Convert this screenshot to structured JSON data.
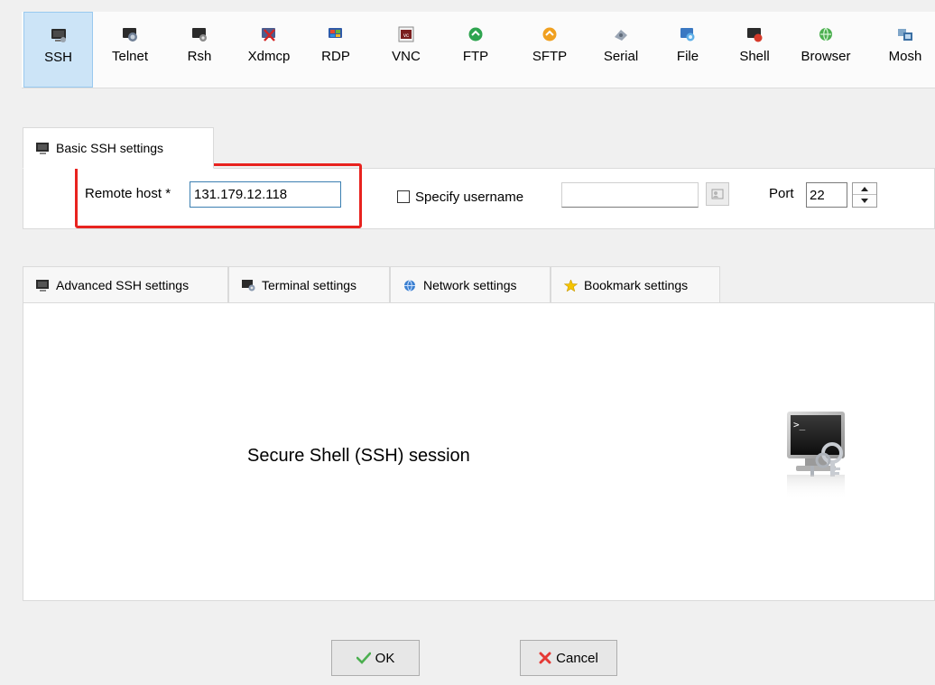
{
  "toolbar": {
    "items": [
      {
        "label": "SSH",
        "icon": "ssh-icon",
        "active": true
      },
      {
        "label": "Telnet",
        "icon": "telnet-icon"
      },
      {
        "label": "Rsh",
        "icon": "rsh-icon"
      },
      {
        "label": "Xdmcp",
        "icon": "xdmcp-icon"
      },
      {
        "label": "RDP",
        "icon": "rdp-icon"
      },
      {
        "label": "VNC",
        "icon": "vnc-icon"
      },
      {
        "label": "FTP",
        "icon": "ftp-icon"
      },
      {
        "label": "SFTP",
        "icon": "sftp-icon"
      },
      {
        "label": "Serial",
        "icon": "serial-icon"
      },
      {
        "label": "File",
        "icon": "file-icon"
      },
      {
        "label": "Shell",
        "icon": "shell-icon"
      },
      {
        "label": "Browser",
        "icon": "browser-icon"
      },
      {
        "label": "Mosh",
        "icon": "mosh-icon"
      }
    ]
  },
  "basic": {
    "tab_label": "Basic SSH settings",
    "remote_host_label": "Remote host *",
    "remote_host_value": "131.179.12.118",
    "specify_username_label": "Specify username",
    "specify_username_checked": false,
    "username_value": "",
    "port_label": "Port",
    "port_value": "22"
  },
  "lower_tabs": [
    {
      "label": "Advanced SSH settings",
      "icon": "terminal-icon"
    },
    {
      "label": "Terminal settings",
      "icon": "terminal-settings-icon"
    },
    {
      "label": "Network settings",
      "icon": "network-icon"
    },
    {
      "label": "Bookmark settings",
      "icon": "star-icon"
    }
  ],
  "description": "Secure Shell (SSH) session",
  "buttons": {
    "ok_label": "OK",
    "cancel_label": "Cancel"
  },
  "colors": {
    "highlight": "#e8231f",
    "active_tab_bg": "#cce4f7",
    "input_focus_border": "#3c7fb1"
  }
}
